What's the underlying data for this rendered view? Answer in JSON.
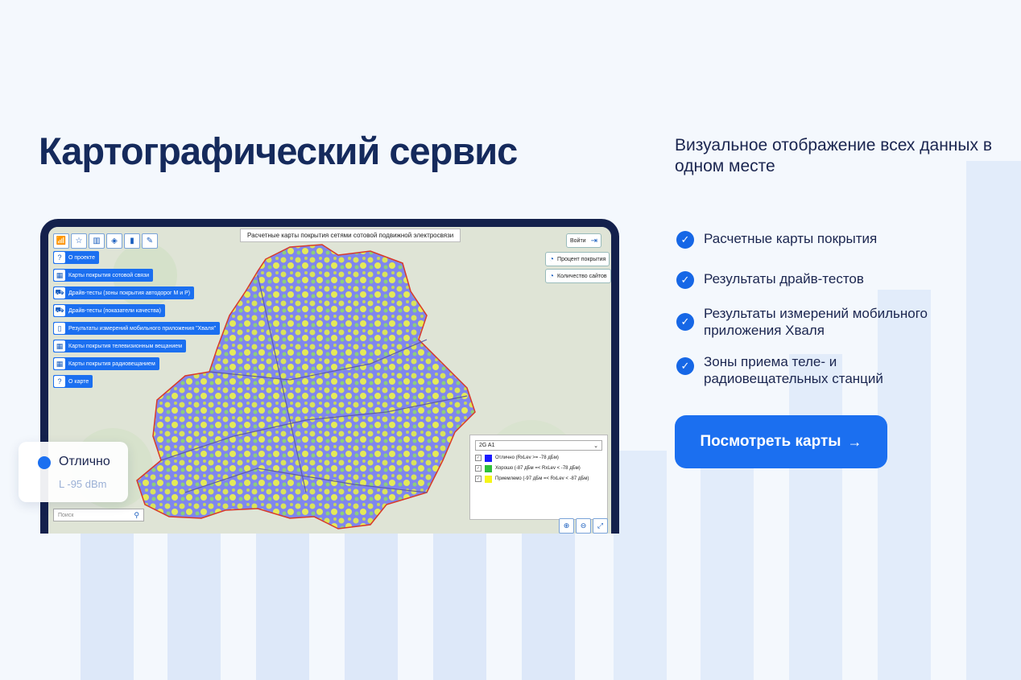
{
  "title": "Картографический сервис",
  "subtitle": "Визуальное отображение всех данных в одном месте",
  "features": [
    "Расчетные карты покрытия",
    "Результаты драйв-тестов",
    "Результаты измерений мобильного приложения Хваля",
    "Зоны приема теле- и радиовещательных станций"
  ],
  "cta": {
    "label": "Посмотреть карты",
    "arrow": "→"
  },
  "map": {
    "title": "Расчетные карты покрытия сетями сотовой подвижной электросвязи",
    "toolbar_icons": [
      "antenna-icon",
      "star-icon",
      "map-icon",
      "layers-icon",
      "book-icon",
      "ruler-icon"
    ],
    "menu": [
      {
        "label": "О проекте",
        "icon": "?"
      },
      {
        "label": "Карты покрытия сотовой связи",
        "icon": "▦"
      },
      {
        "label": "Драйв-тесты (зоны покрытия автодорог М и Р)",
        "icon": "⛟"
      },
      {
        "label": "Драйв-тесты (показатели качества)",
        "icon": "⛟"
      },
      {
        "label": "Результаты измерений мобильного приложения \"Хваля\"",
        "icon": "▯"
      },
      {
        "label": "Карты покрытия телевизионным вещанием",
        "icon": "▦"
      },
      {
        "label": "Карты покрытия радиовещанием",
        "icon": "▦"
      },
      {
        "label": "О карте",
        "icon": "?"
      }
    ],
    "login_label": "Войти",
    "coverage_percent_label": "Процент покрытия",
    "sites_count_label": "Количество сайтов",
    "legend": {
      "selected": "2G A1",
      "items": [
        {
          "label": "Отлично (RxLev >= -78 дБм)",
          "color": "#1a1aff"
        },
        {
          "label": "Хорошо (-87 дБм =< RxLev < -78 дБм)",
          "color": "#2ebf3a"
        },
        {
          "label": "Приемлемо (-97 дБм =< RxLev < -87 дБм)",
          "color": "#f5f518"
        }
      ]
    },
    "search_placeholder": "Поиск"
  },
  "status_card": {
    "label": "Отлично",
    "value": "L -95 dBm"
  },
  "colors": {
    "accent": "#1b6ff0",
    "title": "#152a5c",
    "frame": "#14214c"
  }
}
